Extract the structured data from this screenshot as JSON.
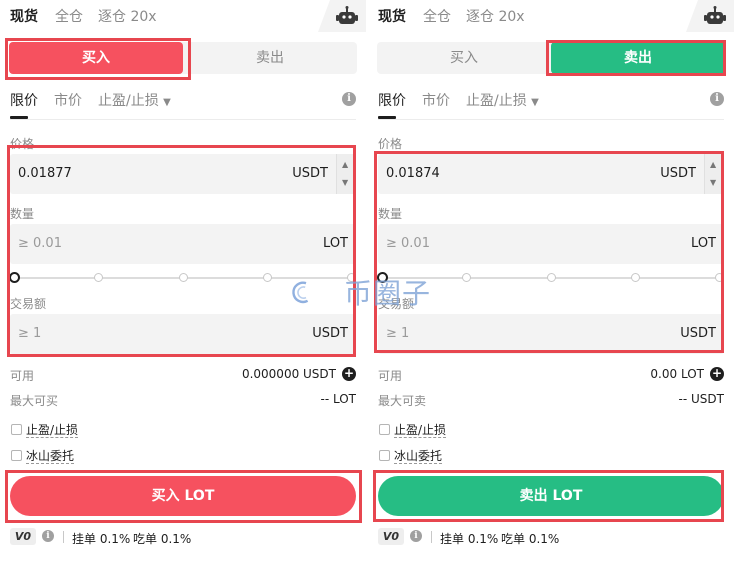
{
  "top_tabs": [
    "现货",
    "全仓",
    "逐仓 20x"
  ],
  "side_tabs": {
    "buy": "买入",
    "sell": "卖出"
  },
  "order_types": {
    "limit": "限价",
    "market": "市价",
    "tpsl": "止盈/止损"
  },
  "labels": {
    "price": "价格",
    "quantity": "数量",
    "amount": "交易额",
    "available": "可用",
    "max_buy": "最大可买",
    "max_sell": "最大可卖",
    "tpsl_checkbox": "止盈/止损",
    "iceberg_checkbox": "冰山委托"
  },
  "buy_panel": {
    "price_value": "0.01877",
    "price_unit": "USDT",
    "quantity_placeholder": "≥ 0.01",
    "quantity_unit": "LOT",
    "amount_placeholder": "≥ 1",
    "amount_unit": "USDT",
    "available_value": "0.000000 USDT",
    "max_value": "-- LOT",
    "submit_label": "买入 LOT",
    "slider_position": 0
  },
  "sell_panel": {
    "price_value": "0.01874",
    "price_unit": "USDT",
    "quantity_placeholder": "≥ 0.01",
    "quantity_unit": "LOT",
    "amount_placeholder": "≥ 1",
    "amount_unit": "USDT",
    "available_value": "0.00 LOT",
    "max_value": "-- USDT",
    "submit_label": "卖出 LOT",
    "slider_position": 0
  },
  "fees": {
    "vip_level": "V0",
    "maker": "挂单 0.1%",
    "taker": "吃单 0.1%"
  },
  "watermark": {
    "text": "币圈子"
  },
  "colors": {
    "buy": "#f6515f",
    "sell": "#26bd84",
    "highlight": "#e7464f"
  },
  "icons": {
    "robot": "robot-icon",
    "info": "info-icon",
    "plus": "plus-circle-icon",
    "dropdown": "caret-down-icon"
  }
}
